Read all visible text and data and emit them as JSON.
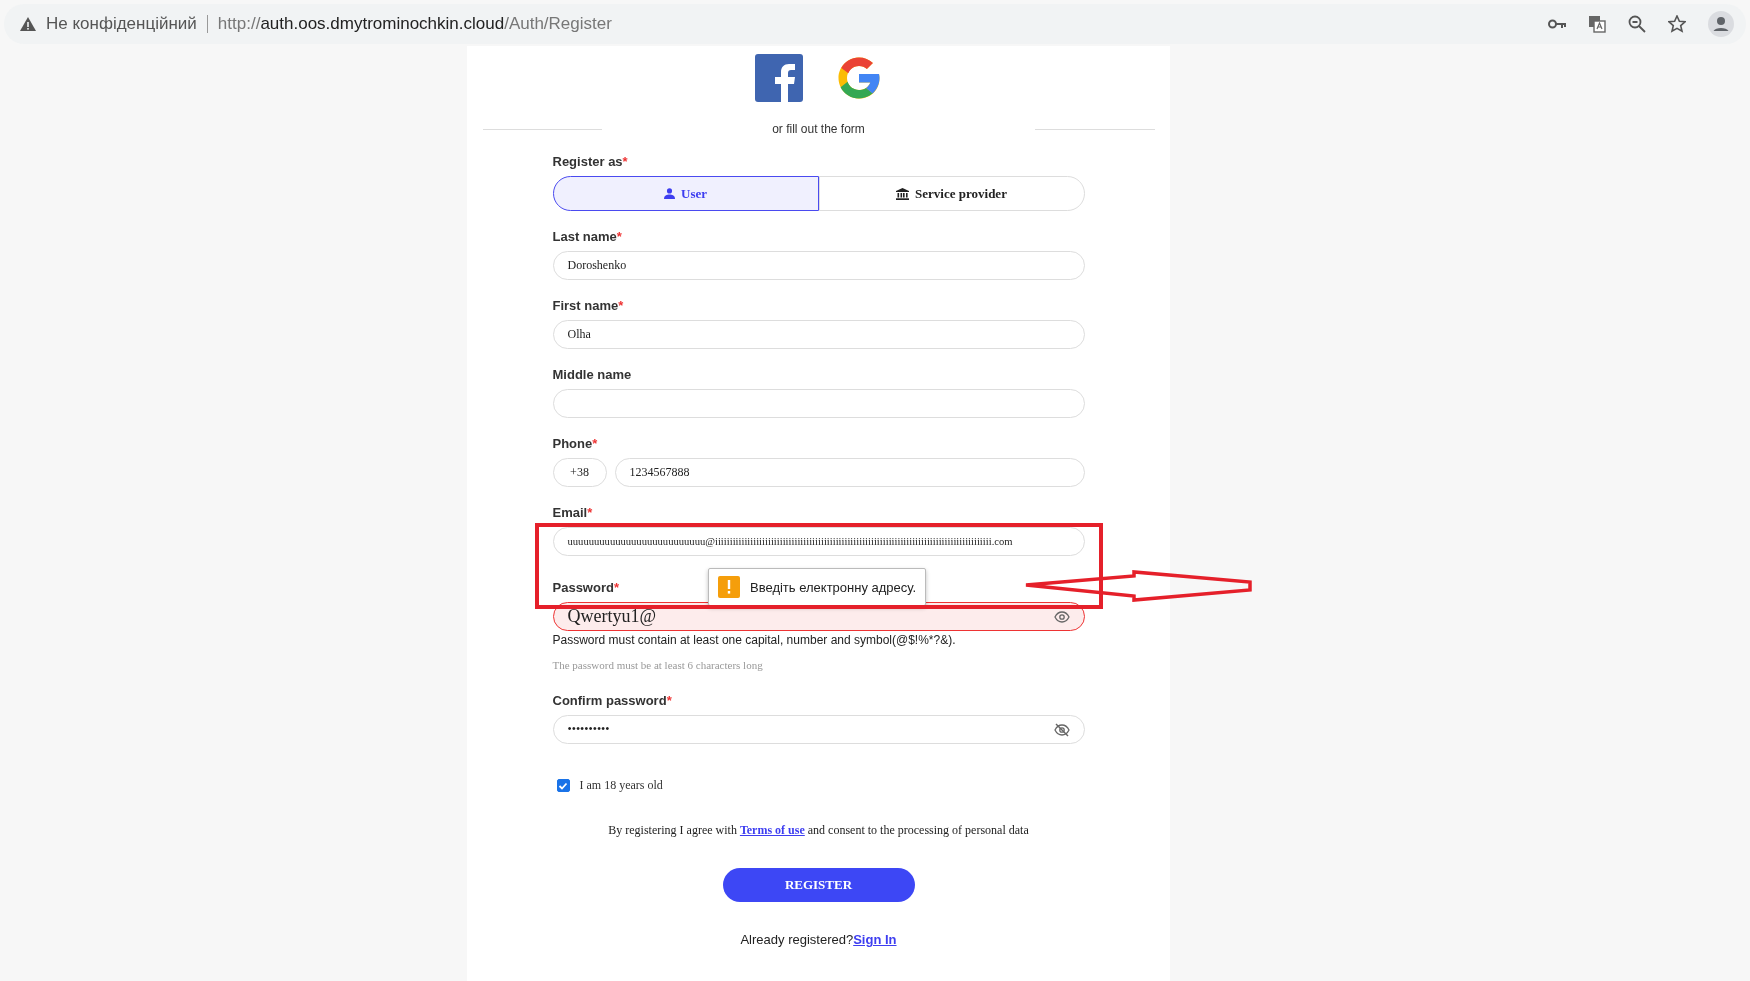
{
  "browser": {
    "security_label": "Не конфіденційний",
    "url": {
      "scheme": "http://",
      "host": "auth.oos.dmytrominochkin.cloud",
      "path": "/Auth/Register"
    }
  },
  "social_divider": "or fill out the form",
  "register_as": {
    "label": "Register as",
    "required_mark": "*",
    "options": [
      {
        "label": "User",
        "kind": "user",
        "selected": true
      },
      {
        "label": "Service provider",
        "kind": "provider",
        "selected": false
      }
    ]
  },
  "fields": [
    {
      "kind": "text",
      "label": "Last name",
      "required_mark": "*",
      "value": "Doroshenko"
    },
    {
      "kind": "text",
      "label": "First name",
      "required_mark": "*",
      "value": "Olha"
    },
    {
      "kind": "text",
      "label": "Middle name"
    },
    {
      "kind": "phone",
      "label": "Phone",
      "required_mark": "*",
      "prefix": "+38",
      "value": "1234567888"
    },
    {
      "kind": "email",
      "label": "Email",
      "required_mark": "*",
      "value": "uuuuuuuuuuuuuuuuuuuuuuuuuu@iiiiiiiiiiiiiiiiiiiiiiiiiiiiiiiiiiiiiiiiiiiiiiiiiiiiiiiiiiiiiiiiiiiiiiiiiiiiiiiiiiiiiiiiiiiiii.com",
      "tooltip": "Введіть електронну адресу."
    },
    {
      "kind": "password",
      "label": "Password",
      "required_mark": "*",
      "value": "Qwertyu1@",
      "revealed": true,
      "invalid": true,
      "error": "Password must contain at least one capital, number and symbol(@$!%*?&).",
      "hint": "The password must be at least 6 characters long"
    },
    {
      "kind": "password",
      "label": "Confirm password",
      "required_mark": "*",
      "value": "••••••••••",
      "revealed": false,
      "invalid": false
    }
  ],
  "age_check": {
    "label": "I am 18 years old",
    "checked": true
  },
  "terms": {
    "before": "By registering I agree with ",
    "link": "Terms of use",
    "after": " and consent to the processing of personal data"
  },
  "register_button": "REGISTER",
  "sign_in": {
    "text": "Already registered?",
    "link": "Sign In"
  }
}
